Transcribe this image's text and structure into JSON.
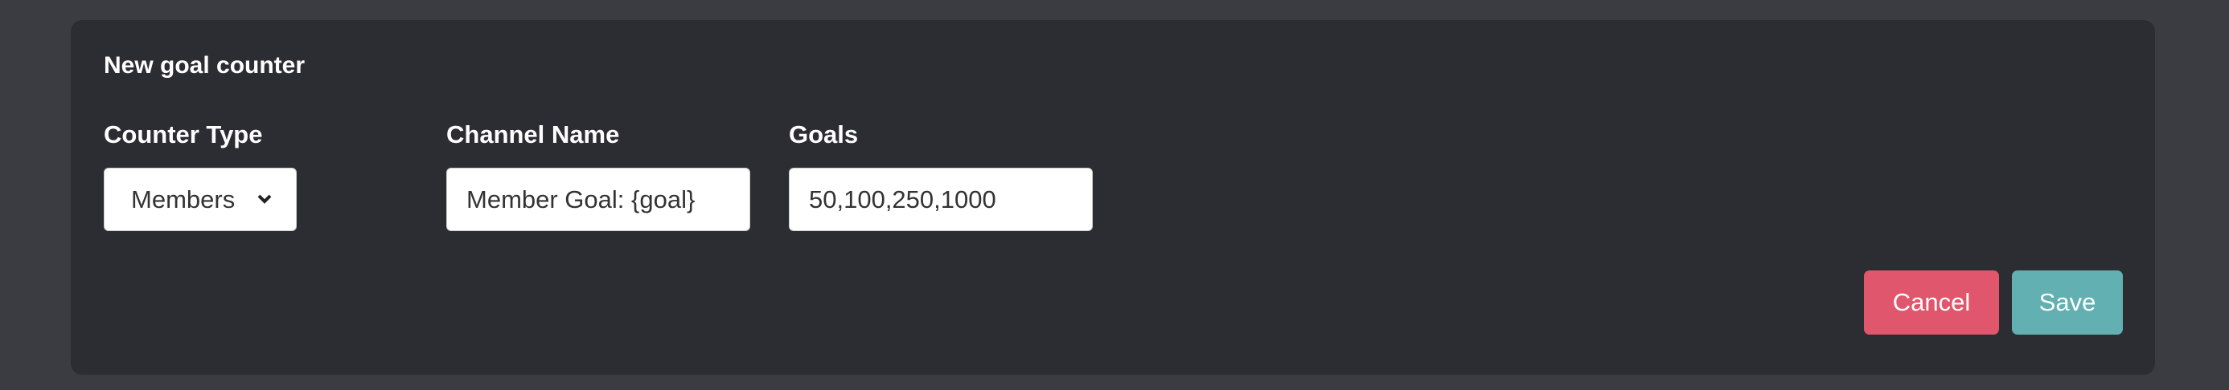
{
  "panel": {
    "title": "New goal counter"
  },
  "form": {
    "counter_type": {
      "label": "Counter Type",
      "value": "Members"
    },
    "channel_name": {
      "label": "Channel Name",
      "value": "Member Goal: {goal}"
    },
    "goals": {
      "label": "Goals",
      "value": "50,100,250,1000"
    }
  },
  "actions": {
    "cancel": "Cancel",
    "save": "Save"
  },
  "colors": {
    "cancel": "#e0566c",
    "save": "#62b0b1",
    "panel": "#2c2d32",
    "background": "#3b3c41"
  }
}
